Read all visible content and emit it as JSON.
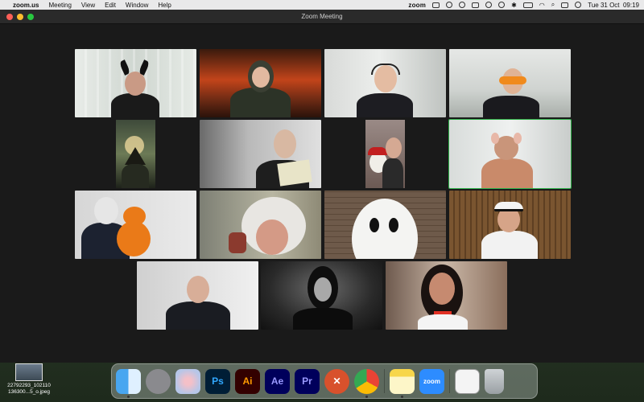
{
  "menubar": {
    "app_name": "zoom.us",
    "items": [
      "Meeting",
      "View",
      "Edit",
      "Window",
      "Help"
    ],
    "status_app": "zoom",
    "datetime": "Tue 31 Oct  09:19"
  },
  "window": {
    "title": "Zoom Meeting"
  },
  "participants": [
    {
      "label": "participant-1"
    },
    {
      "label": "participant-2"
    },
    {
      "label": "participant-3"
    },
    {
      "label": "participant-4"
    },
    {
      "label": "participant-5"
    },
    {
      "label": "participant-6"
    },
    {
      "label": "participant-7"
    },
    {
      "label": "participant-8"
    },
    {
      "label": "participant-9"
    },
    {
      "label": "participant-10"
    },
    {
      "label": "participant-11"
    },
    {
      "label": "participant-12"
    },
    {
      "label": "participant-13"
    },
    {
      "label": "participant-14"
    },
    {
      "label": "participant-15"
    }
  ],
  "active_speaker_color": "#2fb24a",
  "desktop_file": {
    "name_line1": "22792293_102110",
    "name_line2": "136300...5_o.jpeg"
  },
  "dock": {
    "apps": [
      {
        "name": "Finder",
        "icon": "finder-icon",
        "short": ""
      },
      {
        "name": "System Settings",
        "icon": "system-settings-icon",
        "short": ""
      },
      {
        "name": "Launchpad",
        "icon": "launchpad-icon",
        "short": ""
      },
      {
        "name": "Photoshop",
        "icon": "photoshop-icon",
        "short": "Ps"
      },
      {
        "name": "Illustrator",
        "icon": "illustrator-icon",
        "short": "Ai"
      },
      {
        "name": "After Effects",
        "icon": "after-effects-icon",
        "short": "Ae"
      },
      {
        "name": "Premiere Pro",
        "icon": "premiere-pro-icon",
        "short": "Pr"
      },
      {
        "name": "Remote Desktop",
        "icon": "remote-desktop-icon",
        "short": ""
      },
      {
        "name": "Chrome",
        "icon": "chrome-icon",
        "short": ""
      },
      {
        "name": "Notes",
        "icon": "notes-icon",
        "short": ""
      },
      {
        "name": "Zoom",
        "icon": "zoom-icon",
        "short": "zoom"
      },
      {
        "name": "Downloads",
        "icon": "downloads-icon",
        "short": ""
      },
      {
        "name": "Trash",
        "icon": "trash-icon",
        "short": ""
      }
    ]
  }
}
